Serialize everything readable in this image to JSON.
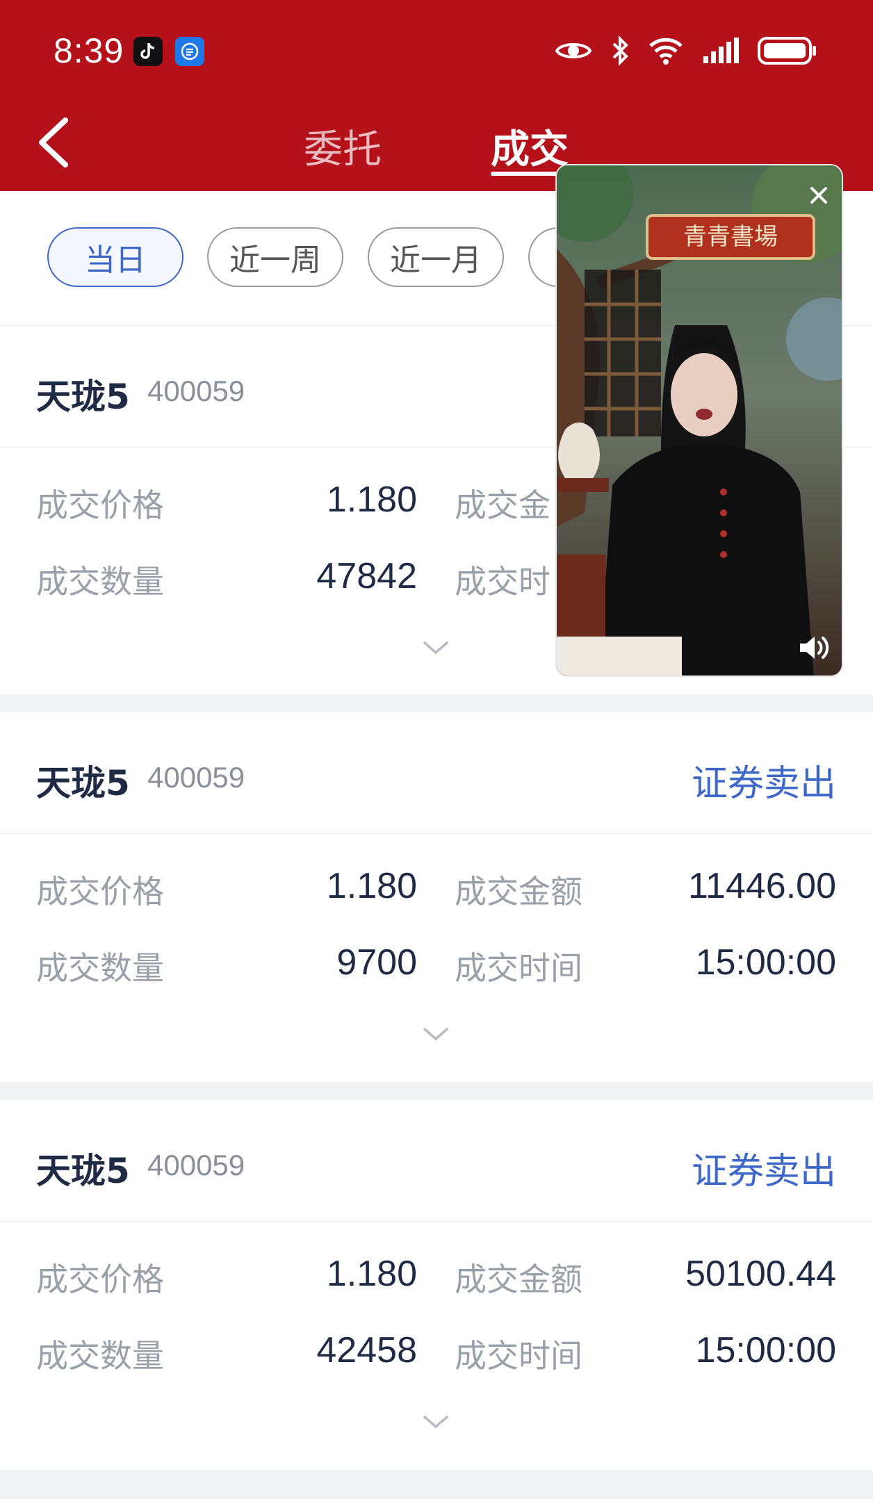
{
  "status_bar": {
    "time": "8:39",
    "app_icons": [
      "tiktok-icon",
      "app-icon"
    ],
    "right_icons": [
      "eye-icon",
      "bluetooth-icon",
      "wifi-icon",
      "signal-icon",
      "battery-icon"
    ]
  },
  "header": {
    "back_icon": "chevron-left-icon",
    "tabs": [
      {
        "label": "委托",
        "active": false
      },
      {
        "label": "成交",
        "active": true
      }
    ]
  },
  "filters": [
    {
      "label": "当日",
      "active": true
    },
    {
      "label": "近一周",
      "active": false
    },
    {
      "label": "近一月",
      "active": false
    }
  ],
  "trades": [
    {
      "name": "天珑5",
      "code": "400059",
      "type": "",
      "price_label": "成交价格",
      "price": "1.180",
      "amount_label": "成交金",
      "amount": "",
      "qty_label": "成交数量",
      "qty": "47842",
      "time_label": "成交时",
      "time": ""
    },
    {
      "name": "天珑5",
      "code": "400059",
      "type": "证券卖出",
      "price_label": "成交价格",
      "price": "1.180",
      "amount_label": "成交金额",
      "amount": "11446.00",
      "qty_label": "成交数量",
      "qty": "9700",
      "time_label": "成交时间",
      "time": "15:00:00"
    },
    {
      "name": "天珑5",
      "code": "400059",
      "type": "证券卖出",
      "price_label": "成交价格",
      "price": "1.180",
      "amount_label": "成交金额",
      "amount": "50100.44",
      "qty_label": "成交数量",
      "qty": "42458",
      "time_label": "成交时间",
      "time": "15:00:00"
    }
  ],
  "video_popup": {
    "sign_text": "青青書場",
    "close_icon": "close-icon",
    "sound_icon": "speaker-icon"
  },
  "colors": {
    "header": "#b4111b",
    "accent": "#3d67c8",
    "text": "#1f2a44",
    "muted": "#9aa0aa"
  }
}
